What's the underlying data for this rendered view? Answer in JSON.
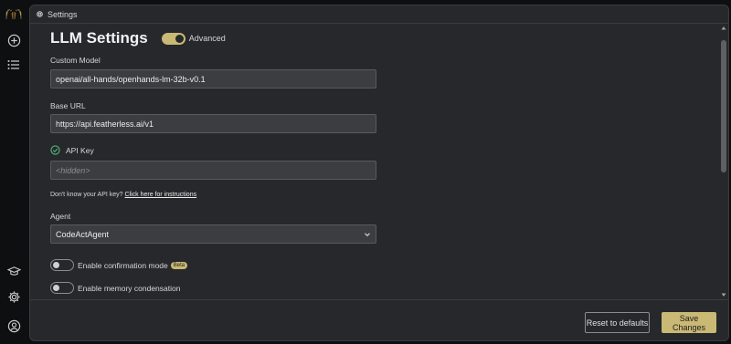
{
  "sidebar": {
    "logo_icon": "hands-logo-icon",
    "new_icon": "plus-circle-icon",
    "list_icon": "list-icon",
    "docs_icon": "graduation-cap-icon",
    "settings_icon": "gear-icon",
    "user_icon": "user-circle-icon"
  },
  "header": {
    "title": "Settings",
    "icon": "gear-icon"
  },
  "main": {
    "title": "LLM Settings",
    "advanced_label": "Advanced",
    "advanced_enabled": true,
    "custom_model_label": "Custom Model",
    "custom_model_value": "openai/all-hands/openhands-lm-32b-v0.1",
    "base_url_label": "Base URL",
    "base_url_value": "https://api.featherless.ai/v1",
    "api_key_label": "API Key",
    "api_key_placeholder": "<hidden>",
    "help_text": "Don't know your API key?",
    "help_link": "Click here for instructions",
    "agent_label": "Agent",
    "agent_value": "CodeActAgent",
    "confirmation_label": "Enable confirmation mode",
    "beta_badge": "Beta",
    "confirmation_enabled": false,
    "memory_label": "Enable memory condensation",
    "memory_enabled": false
  },
  "footer": {
    "reset_label": "Reset to defaults",
    "save_label": "Save Changes"
  },
  "colors": {
    "accent": "#c9b974",
    "panel": "#26282b",
    "success": "#57b77a"
  }
}
